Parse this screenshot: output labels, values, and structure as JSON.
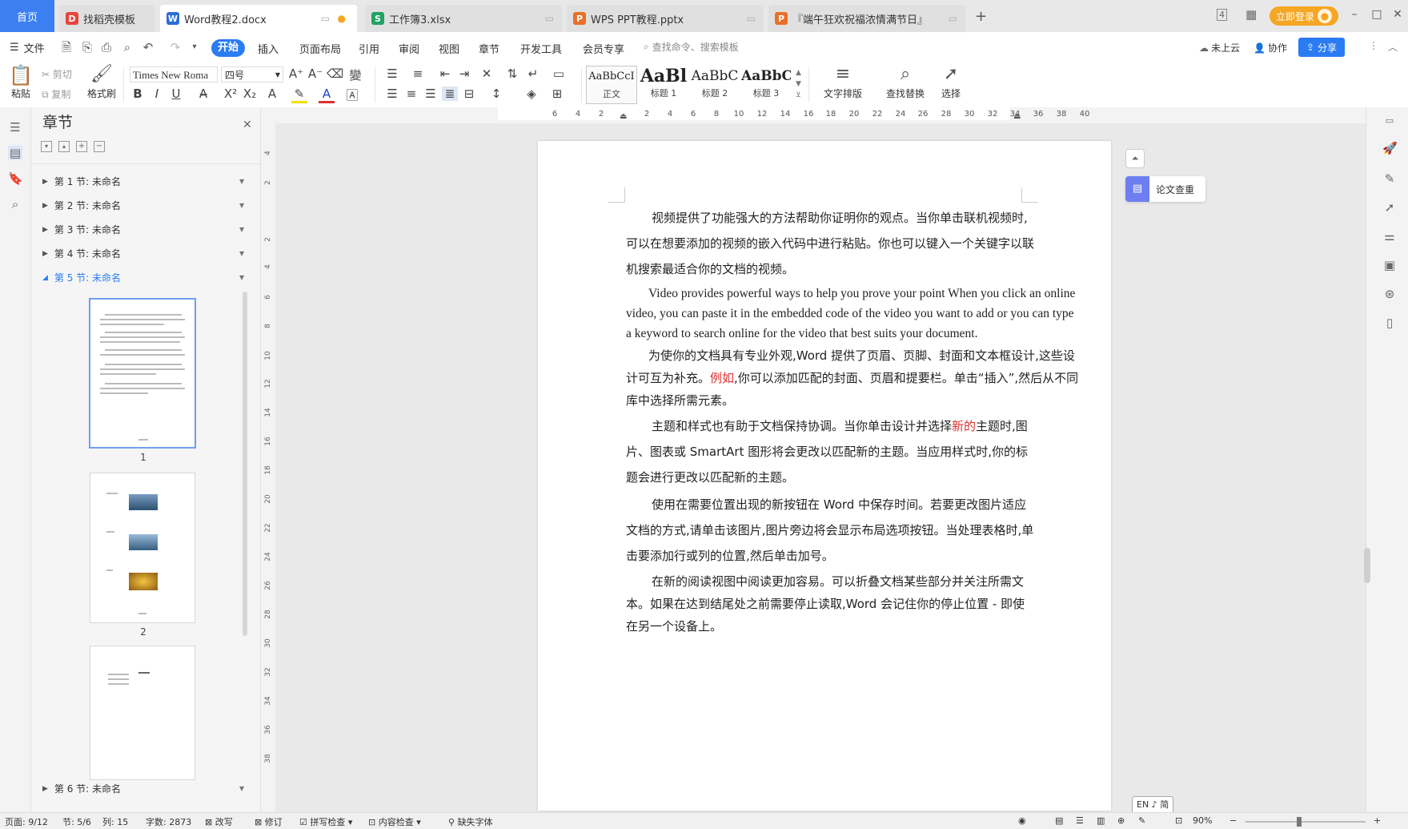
{
  "tabs": {
    "home": "首页",
    "t1": "找稻壳模板",
    "t2": "Word教程2.docx",
    "t3": "工作簿3.xlsx",
    "t4": "WPS PPT教程.pptx",
    "t5": "『端午狂欢祝福浓情满节日』",
    "login": "立即登录"
  },
  "menu": {
    "file": "文件",
    "items": [
      "开始",
      "插入",
      "页面布局",
      "引用",
      "审阅",
      "视图",
      "章节",
      "开发工具",
      "会员专享"
    ],
    "search_placeholder": "查找命令、搜索模板",
    "cloud": "未上云",
    "collab": "协作",
    "share": "分享"
  },
  "ribbon": {
    "paste": "粘贴",
    "cut": "剪切",
    "copy": "复制",
    "format_painter": "格式刷",
    "font": "Times New Roma",
    "size": "四号",
    "styles": [
      {
        "sample": "AaBbCcI",
        "label": "正文"
      },
      {
        "sample": "AaBl",
        "label": "标题 1"
      },
      {
        "sample": "AaBbC",
        "label": "标题 2"
      },
      {
        "sample": "AaBbC",
        "label": "标题 3"
      }
    ],
    "text_layout": "文字排版",
    "find_replace": "查找替换",
    "select": "选择"
  },
  "panel": {
    "title": "章节",
    "sections": [
      "第 1 节: 未命名",
      "第 2 节: 未命名",
      "第 3 节: 未命名",
      "第 4 节: 未命名",
      "第 5 节: 未命名"
    ],
    "last_section": "第 6 节: 未命名",
    "page_nums": [
      "1",
      "2"
    ]
  },
  "ruler_h": [
    "6",
    "4",
    "2",
    "2",
    "4",
    "6",
    "8",
    "10",
    "12",
    "14",
    "16",
    "18",
    "20",
    "22",
    "24",
    "26",
    "28",
    "30",
    "32",
    "34",
    "36",
    "38",
    "40"
  ],
  "ruler_v": [
    "4",
    "2",
    "2",
    "4",
    "6",
    "8",
    "10",
    "12",
    "14",
    "16",
    "18",
    "20",
    "22",
    "24",
    "26",
    "28",
    "30",
    "32",
    "34",
    "36",
    "38"
  ],
  "document": {
    "p1": "视频提供了功能强大的方法帮助你证明你的观点。当你单击联机视频时,可以在想要添加的视频的嵌入代码中进行粘贴。你也可以键入一个关键字以联机搜索最适合你的文档的视频。",
    "p2": "Video provides powerful ways to help you prove your point When you click an online video, you can paste it in the embedded code of the video you want to add or you can type a keyword to search online for the video that best suits your document.",
    "p3a": "为使你的文档具有专业外观,Word 提供了页眉、页脚、封面和文本框设计,这些设计可互为补充。",
    "p3red": "例如",
    "p3b": ",你可以添加匹配的封面、页眉和提要栏。单击“插入”,然后从不同库中选择所需元素。",
    "p4a": "主题和样式也有助于文档保持协调。当你单击设计并选择",
    "p4red": "新的",
    "p4b": "主题时,图片、图表或 SmartArt 图形将会更改以匹配新的主题。当应用样式时,你的标题会进行更改以匹配新的主题。",
    "p5": "使用在需要位置出现的新按钮在 Word 中保存时间。若要更改图片适应文档的方式,请单击该图片,图片旁边将会显示布局选项按钮。当处理表格时,单击要添加行或列的位置,然后单击加号。",
    "p6": "在新的阅读视图中阅读更加容易。可以折叠文档某些部分并关注所需文本。如果在达到结尾处之前需要停止读取,Word 会记住你的停止位置 - 即使在另一个设备上。"
  },
  "float": {
    "plagiarism": "论文查重",
    "ime": "EN ♪ 简"
  },
  "status": {
    "page": "页面: 9/12",
    "section": "节: 5/6",
    "col": "列: 15",
    "words": "字数: 2873",
    "overwrite": "改写",
    "revise": "修订",
    "spell": "拼写检查",
    "content": "内容检查",
    "missing_font": "缺失字体",
    "zoom": "90%"
  },
  "colors": {
    "accent": "#2b7cf2",
    "active_section": "#2b7cf2",
    "login": "#f5a623",
    "red_text": "#e03030"
  }
}
